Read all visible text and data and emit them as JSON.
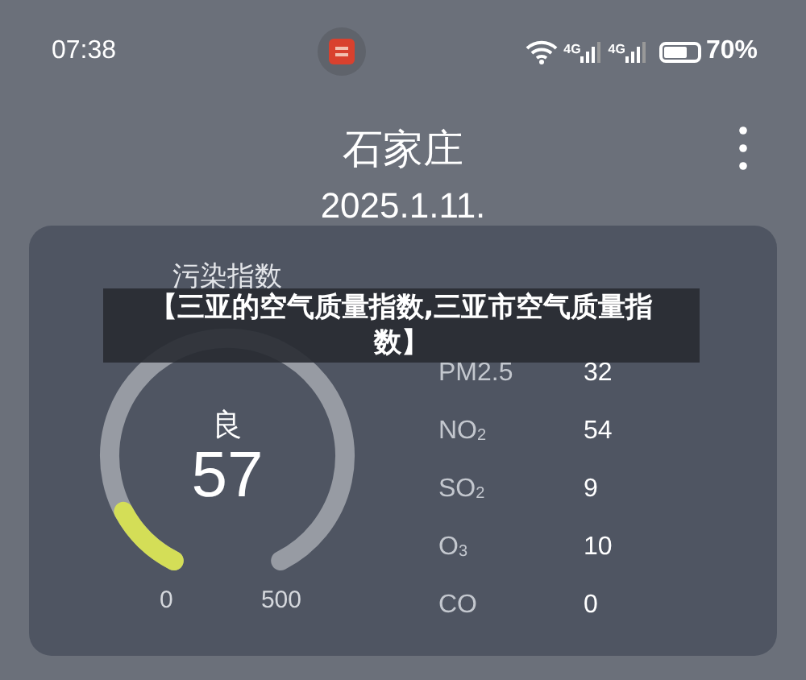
{
  "status_bar": {
    "time": "07:38",
    "networks": [
      "4G",
      "4G"
    ],
    "battery": "70%"
  },
  "header": {
    "title": "石家庄",
    "date": "2025.1.11."
  },
  "card": {
    "title": "污染指数",
    "gauge": {
      "quality": "良",
      "value": "57",
      "min": "0",
      "max": "500"
    },
    "pollutants": [
      {
        "name": "PM2.5",
        "value": "32"
      },
      {
        "name": "NO$_{2}$",
        "value": "54"
      },
      {
        "name": "SO$_{2}$",
        "value": "9"
      },
      {
        "name": "O$_{3}$",
        "value": "10"
      },
      {
        "name": "CO",
        "value": "0"
      }
    ]
  },
  "caption": "【三亚的空气质量指数,三亚市空气质量指数】"
}
